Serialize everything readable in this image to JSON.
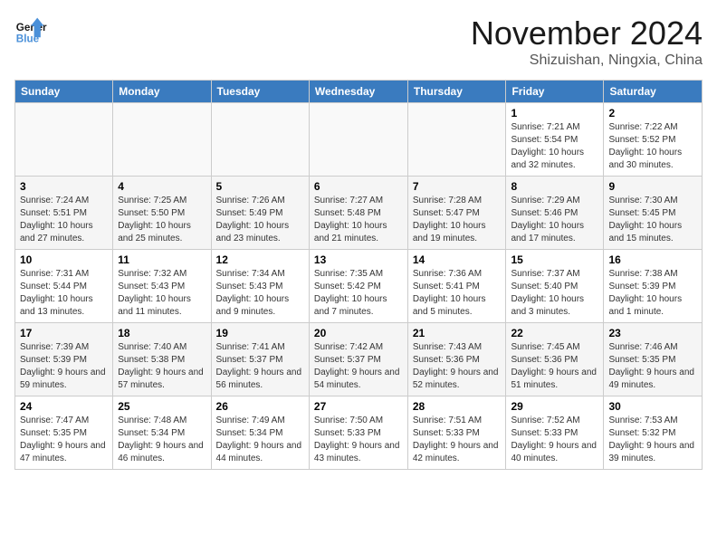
{
  "logo": {
    "line1": "General",
    "line2": "Blue"
  },
  "title": "November 2024",
  "location": "Shizuishan, Ningxia, China",
  "days_of_week": [
    "Sunday",
    "Monday",
    "Tuesday",
    "Wednesday",
    "Thursday",
    "Friday",
    "Saturday"
  ],
  "weeks": [
    [
      {
        "day": "",
        "info": ""
      },
      {
        "day": "",
        "info": ""
      },
      {
        "day": "",
        "info": ""
      },
      {
        "day": "",
        "info": ""
      },
      {
        "day": "",
        "info": ""
      },
      {
        "day": "1",
        "info": "Sunrise: 7:21 AM\nSunset: 5:54 PM\nDaylight: 10 hours and 32 minutes."
      },
      {
        "day": "2",
        "info": "Sunrise: 7:22 AM\nSunset: 5:52 PM\nDaylight: 10 hours and 30 minutes."
      }
    ],
    [
      {
        "day": "3",
        "info": "Sunrise: 7:24 AM\nSunset: 5:51 PM\nDaylight: 10 hours and 27 minutes."
      },
      {
        "day": "4",
        "info": "Sunrise: 7:25 AM\nSunset: 5:50 PM\nDaylight: 10 hours and 25 minutes."
      },
      {
        "day": "5",
        "info": "Sunrise: 7:26 AM\nSunset: 5:49 PM\nDaylight: 10 hours and 23 minutes."
      },
      {
        "day": "6",
        "info": "Sunrise: 7:27 AM\nSunset: 5:48 PM\nDaylight: 10 hours and 21 minutes."
      },
      {
        "day": "7",
        "info": "Sunrise: 7:28 AM\nSunset: 5:47 PM\nDaylight: 10 hours and 19 minutes."
      },
      {
        "day": "8",
        "info": "Sunrise: 7:29 AM\nSunset: 5:46 PM\nDaylight: 10 hours and 17 minutes."
      },
      {
        "day": "9",
        "info": "Sunrise: 7:30 AM\nSunset: 5:45 PM\nDaylight: 10 hours and 15 minutes."
      }
    ],
    [
      {
        "day": "10",
        "info": "Sunrise: 7:31 AM\nSunset: 5:44 PM\nDaylight: 10 hours and 13 minutes."
      },
      {
        "day": "11",
        "info": "Sunrise: 7:32 AM\nSunset: 5:43 PM\nDaylight: 10 hours and 11 minutes."
      },
      {
        "day": "12",
        "info": "Sunrise: 7:34 AM\nSunset: 5:43 PM\nDaylight: 10 hours and 9 minutes."
      },
      {
        "day": "13",
        "info": "Sunrise: 7:35 AM\nSunset: 5:42 PM\nDaylight: 10 hours and 7 minutes."
      },
      {
        "day": "14",
        "info": "Sunrise: 7:36 AM\nSunset: 5:41 PM\nDaylight: 10 hours and 5 minutes."
      },
      {
        "day": "15",
        "info": "Sunrise: 7:37 AM\nSunset: 5:40 PM\nDaylight: 10 hours and 3 minutes."
      },
      {
        "day": "16",
        "info": "Sunrise: 7:38 AM\nSunset: 5:39 PM\nDaylight: 10 hours and 1 minute."
      }
    ],
    [
      {
        "day": "17",
        "info": "Sunrise: 7:39 AM\nSunset: 5:39 PM\nDaylight: 9 hours and 59 minutes."
      },
      {
        "day": "18",
        "info": "Sunrise: 7:40 AM\nSunset: 5:38 PM\nDaylight: 9 hours and 57 minutes."
      },
      {
        "day": "19",
        "info": "Sunrise: 7:41 AM\nSunset: 5:37 PM\nDaylight: 9 hours and 56 minutes."
      },
      {
        "day": "20",
        "info": "Sunrise: 7:42 AM\nSunset: 5:37 PM\nDaylight: 9 hours and 54 minutes."
      },
      {
        "day": "21",
        "info": "Sunrise: 7:43 AM\nSunset: 5:36 PM\nDaylight: 9 hours and 52 minutes."
      },
      {
        "day": "22",
        "info": "Sunrise: 7:45 AM\nSunset: 5:36 PM\nDaylight: 9 hours and 51 minutes."
      },
      {
        "day": "23",
        "info": "Sunrise: 7:46 AM\nSunset: 5:35 PM\nDaylight: 9 hours and 49 minutes."
      }
    ],
    [
      {
        "day": "24",
        "info": "Sunrise: 7:47 AM\nSunset: 5:35 PM\nDaylight: 9 hours and 47 minutes."
      },
      {
        "day": "25",
        "info": "Sunrise: 7:48 AM\nSunset: 5:34 PM\nDaylight: 9 hours and 46 minutes."
      },
      {
        "day": "26",
        "info": "Sunrise: 7:49 AM\nSunset: 5:34 PM\nDaylight: 9 hours and 44 minutes."
      },
      {
        "day": "27",
        "info": "Sunrise: 7:50 AM\nSunset: 5:33 PM\nDaylight: 9 hours and 43 minutes."
      },
      {
        "day": "28",
        "info": "Sunrise: 7:51 AM\nSunset: 5:33 PM\nDaylight: 9 hours and 42 minutes."
      },
      {
        "day": "29",
        "info": "Sunrise: 7:52 AM\nSunset: 5:33 PM\nDaylight: 9 hours and 40 minutes."
      },
      {
        "day": "30",
        "info": "Sunrise: 7:53 AM\nSunset: 5:32 PM\nDaylight: 9 hours and 39 minutes."
      }
    ]
  ]
}
